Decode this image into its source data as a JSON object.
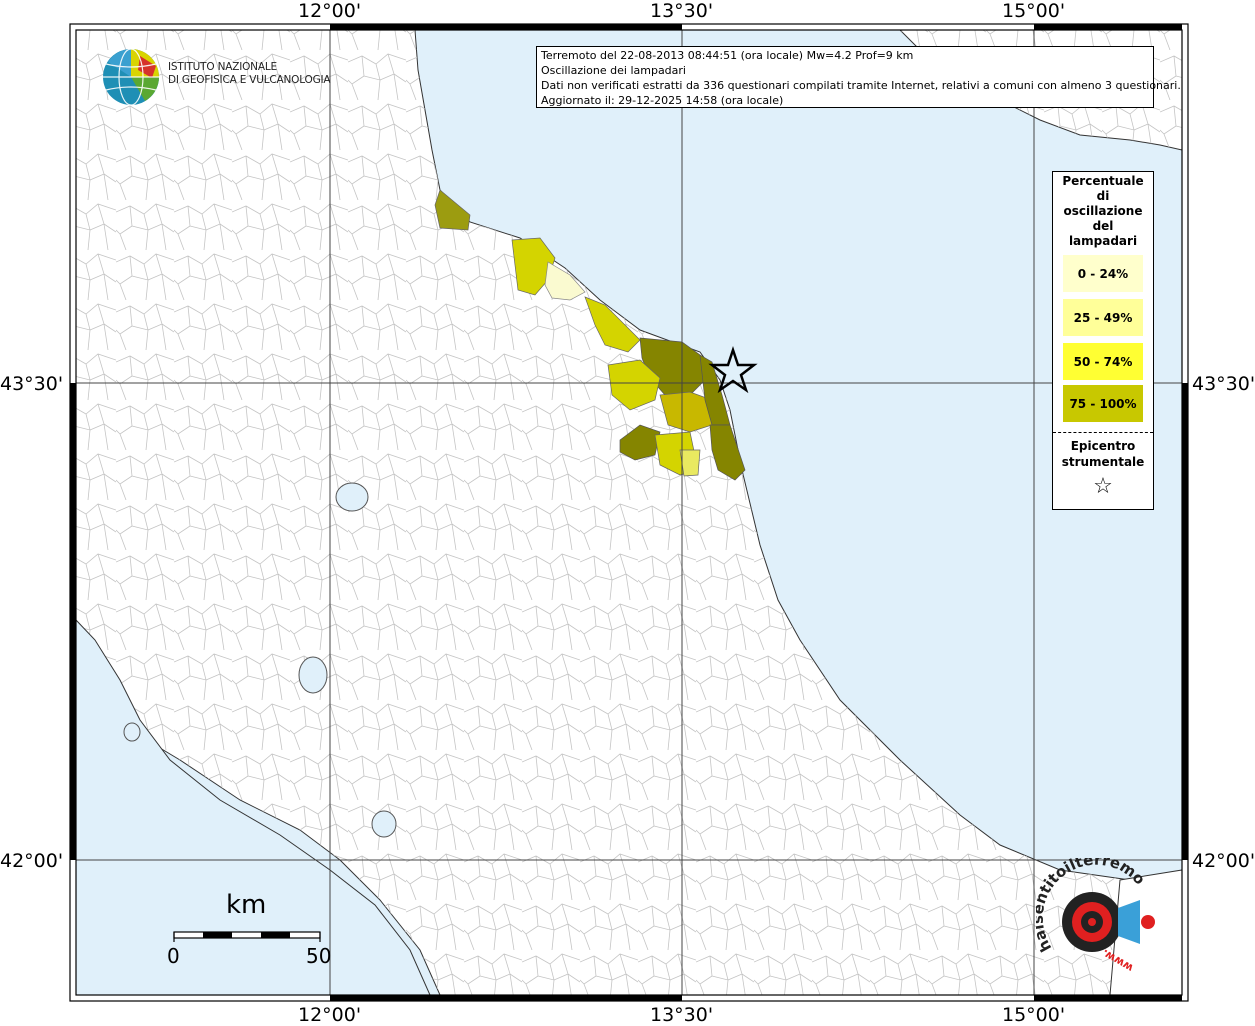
{
  "axes": {
    "top_labels": [
      "12°00'",
      "13°30'",
      "15°00'"
    ],
    "bottom_labels": [
      "12°00'",
      "13°30'",
      "15°00'"
    ],
    "left_labels": [
      "43°30'",
      "42°00'"
    ],
    "right_labels": [
      "43°30'",
      "42°00'"
    ]
  },
  "info": {
    "line1": "Terremoto del 22-08-2013 08:44:51 (ora locale) Mw=4.2 Prof=9 km",
    "line2": "Oscillazione dei lampadari",
    "line3": "Dati non verificati estratti da 336 questionari compilati tramite Internet, relativi a comuni con almeno 3 questionari.",
    "line4": "Aggiornato il: 29-12-2025 14:58 (ora locale)"
  },
  "logo": {
    "line1": "ISTITUTO NAZIONALE",
    "line2": "DI GEOFISICA E VULCANOLOGIA"
  },
  "legend": {
    "title_lines": [
      "Percentuale",
      "di",
      "oscillazione",
      "del",
      "lampadari"
    ],
    "items": [
      {
        "label": "0 - 24%",
        "color": "#ffffcc"
      },
      {
        "label": "25 - 49%",
        "color": "#ffff99"
      },
      {
        "label": "50 - 74%",
        "color": "#ffff33"
      },
      {
        "label": "75 - 100%",
        "color": "#c8c800"
      }
    ],
    "epicenter_lines": [
      "Epicentro",
      "strumentale"
    ],
    "epicenter_symbol": "☆"
  },
  "scale": {
    "unit": "km",
    "min": "0",
    "max": "50"
  },
  "watermark": {
    "text_arc": "haisentitoilterremoto.it",
    "text_www": "www."
  },
  "colors": {
    "sea": "#e0f0fa",
    "land": "#ffffff",
    "boundary": "#c4c4c4",
    "class_light": "#fafad0",
    "class_mid": "#d4d400",
    "class_dark": "#9c9c10",
    "class_olive": "#858500"
  }
}
